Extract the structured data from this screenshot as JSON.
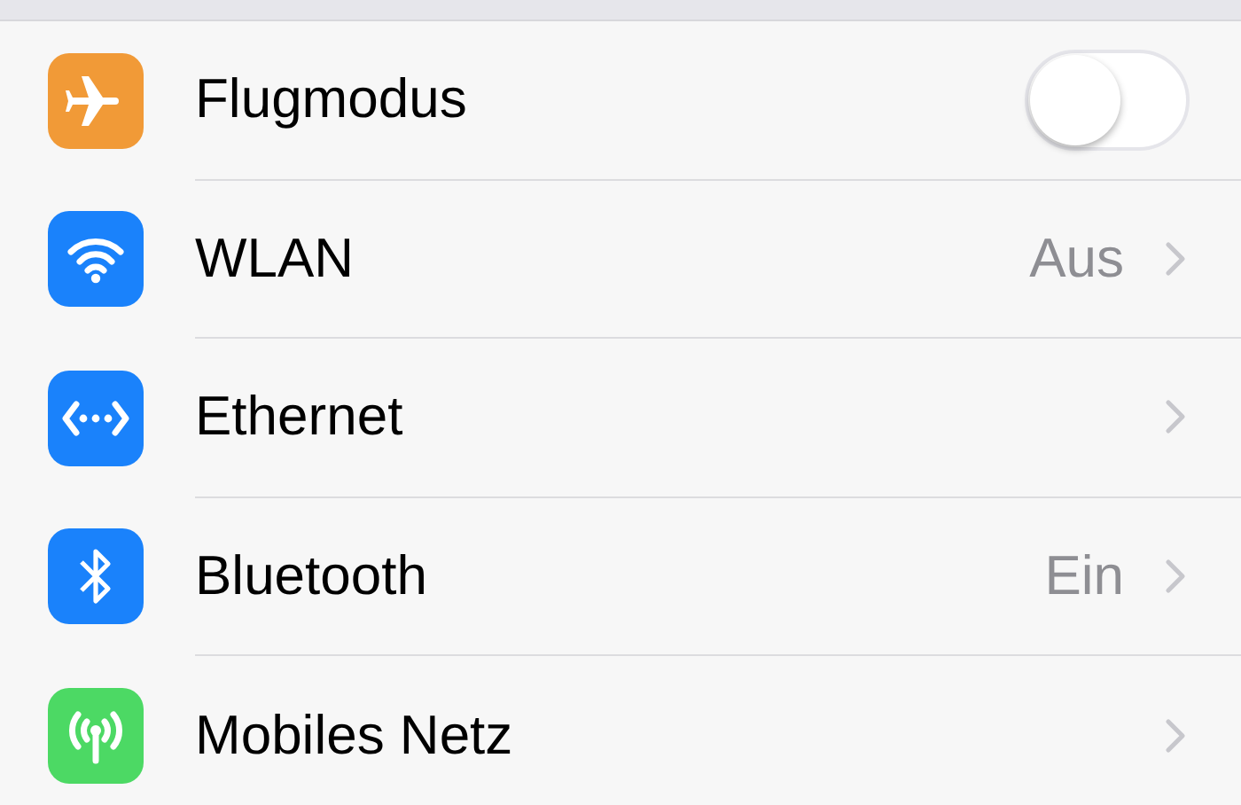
{
  "rows": [
    {
      "kind": "toggle",
      "color": "#f19a37",
      "label": "Flugmodus",
      "on": false
    },
    {
      "kind": "link",
      "color": "#1a82fb",
      "label": "WLAN",
      "value": "Aus"
    },
    {
      "kind": "link",
      "color": "#1a82fb",
      "label": "Ethernet"
    },
    {
      "kind": "link",
      "color": "#1a82fb",
      "label": "Bluetooth",
      "value": "Ein"
    },
    {
      "kind": "link",
      "color": "#4cd964",
      "label": "Mobiles Netz"
    }
  ]
}
